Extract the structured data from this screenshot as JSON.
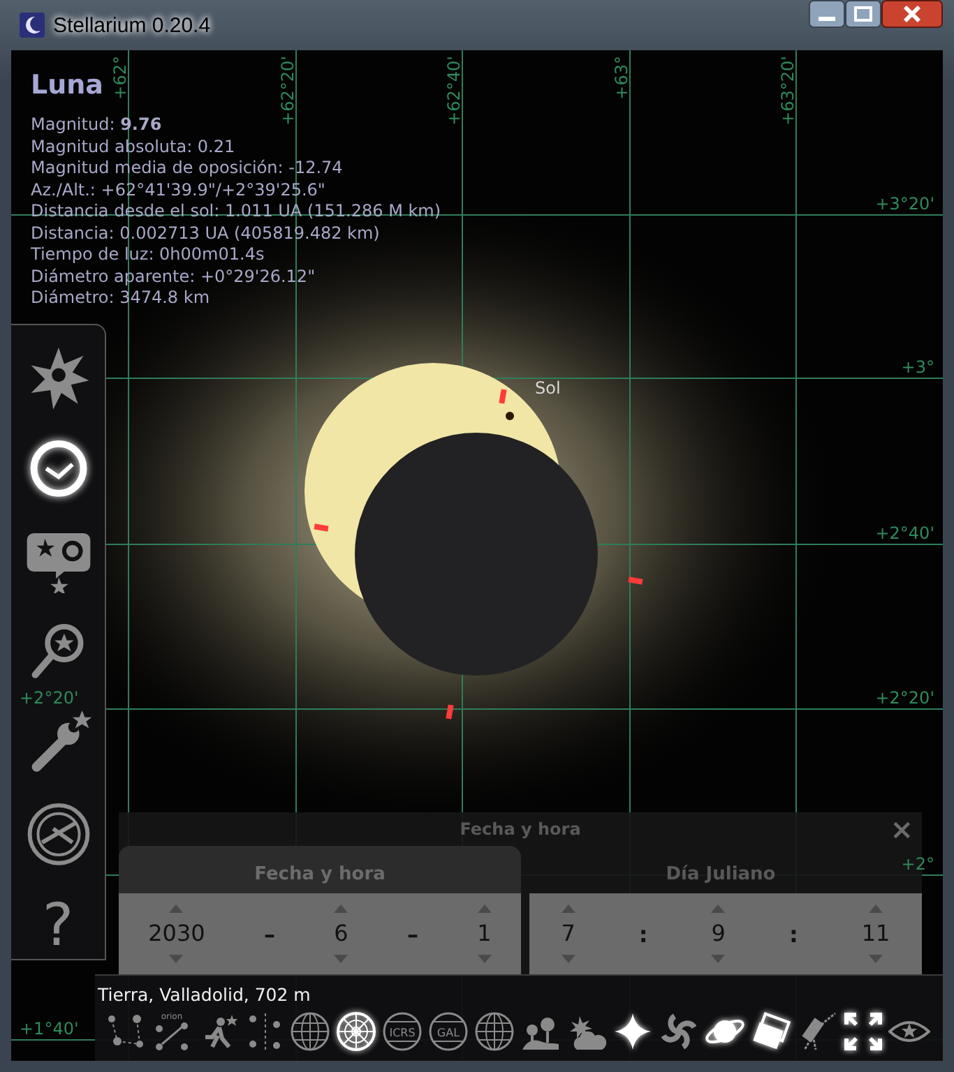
{
  "window": {
    "title": "Stellarium 0.20.4"
  },
  "sky": {
    "top_labels": [
      "+62°",
      "+62°20'",
      "+62°40'",
      "+63°",
      "+63°20'"
    ],
    "right_labels": [
      "+3°20'",
      "+3°",
      "+2°40'",
      "+2°20'",
      "+2°"
    ],
    "left_labels": [
      "+2°20'",
      "+1°40'"
    ],
    "sun_label": "Sol"
  },
  "info": {
    "title": "Luna",
    "lines": [
      "Magnitud: **9.76**",
      "Magnitud absoluta: 0.21",
      "Magnitud media de oposición: -12.74",
      "Az./Alt.: +62°41'39.9\"/+2°39'25.6\"",
      "Distancia desde el sol: 1.011 UA (151.286 M km)",
      "Distancia: 0.002713 UA (405819.482 km)",
      "Tiempo de luz: 0h00m01.4s",
      "Diámetro aparente: +0°29'26.12\"",
      "Diámetro: 3474.8 km"
    ]
  },
  "sidebar": {
    "items": [
      {
        "kind": "location",
        "on": false
      },
      {
        "kind": "datetime",
        "on": true
      },
      {
        "kind": "skyview",
        "on": false
      },
      {
        "kind": "search",
        "on": false
      },
      {
        "kind": "config",
        "on": false
      },
      {
        "kind": "astrolabe",
        "on": false
      },
      {
        "kind": "help",
        "on": false,
        "label": "?"
      }
    ]
  },
  "dialog": {
    "title": "Fecha y hora",
    "close": "×",
    "tabs": [
      {
        "label": "Fecha y hora",
        "selected": true
      },
      {
        "label": "Día Juliano",
        "selected": false
      }
    ],
    "date_fields": [
      "2030",
      "6",
      "1"
    ],
    "date_separators": [
      "–",
      "–"
    ],
    "time_fields": [
      "7",
      "9",
      "11"
    ],
    "time_separators": [
      ":",
      ":"
    ]
  },
  "status": {
    "location": "Tierra, Valladolid, 702 m"
  },
  "toolbar": [
    {
      "kind": "lines",
      "on": false
    },
    {
      "kind": "names",
      "on": false,
      "label": "orion"
    },
    {
      "kind": "art",
      "on": false
    },
    {
      "kind": "bounds",
      "on": false
    },
    {
      "kind": "globe",
      "on": false
    },
    {
      "kind": "radar",
      "on": true
    },
    {
      "kind": "textglobe",
      "on": false,
      "label": "ICRS"
    },
    {
      "kind": "textglobe",
      "on": false,
      "label": "GAL"
    },
    {
      "kind": "globe",
      "on": false
    },
    {
      "kind": "ground",
      "on": false
    },
    {
      "kind": "atmosphere",
      "on": false
    },
    {
      "kind": "star",
      "on": true
    },
    {
      "kind": "galaxy",
      "on": false
    },
    {
      "kind": "planet",
      "on": true
    },
    {
      "kind": "pictures",
      "on": true
    },
    {
      "kind": "telescope",
      "on": false
    },
    {
      "kind": "fullscreen",
      "on": true
    },
    {
      "kind": "eye",
      "on": false
    }
  ]
}
